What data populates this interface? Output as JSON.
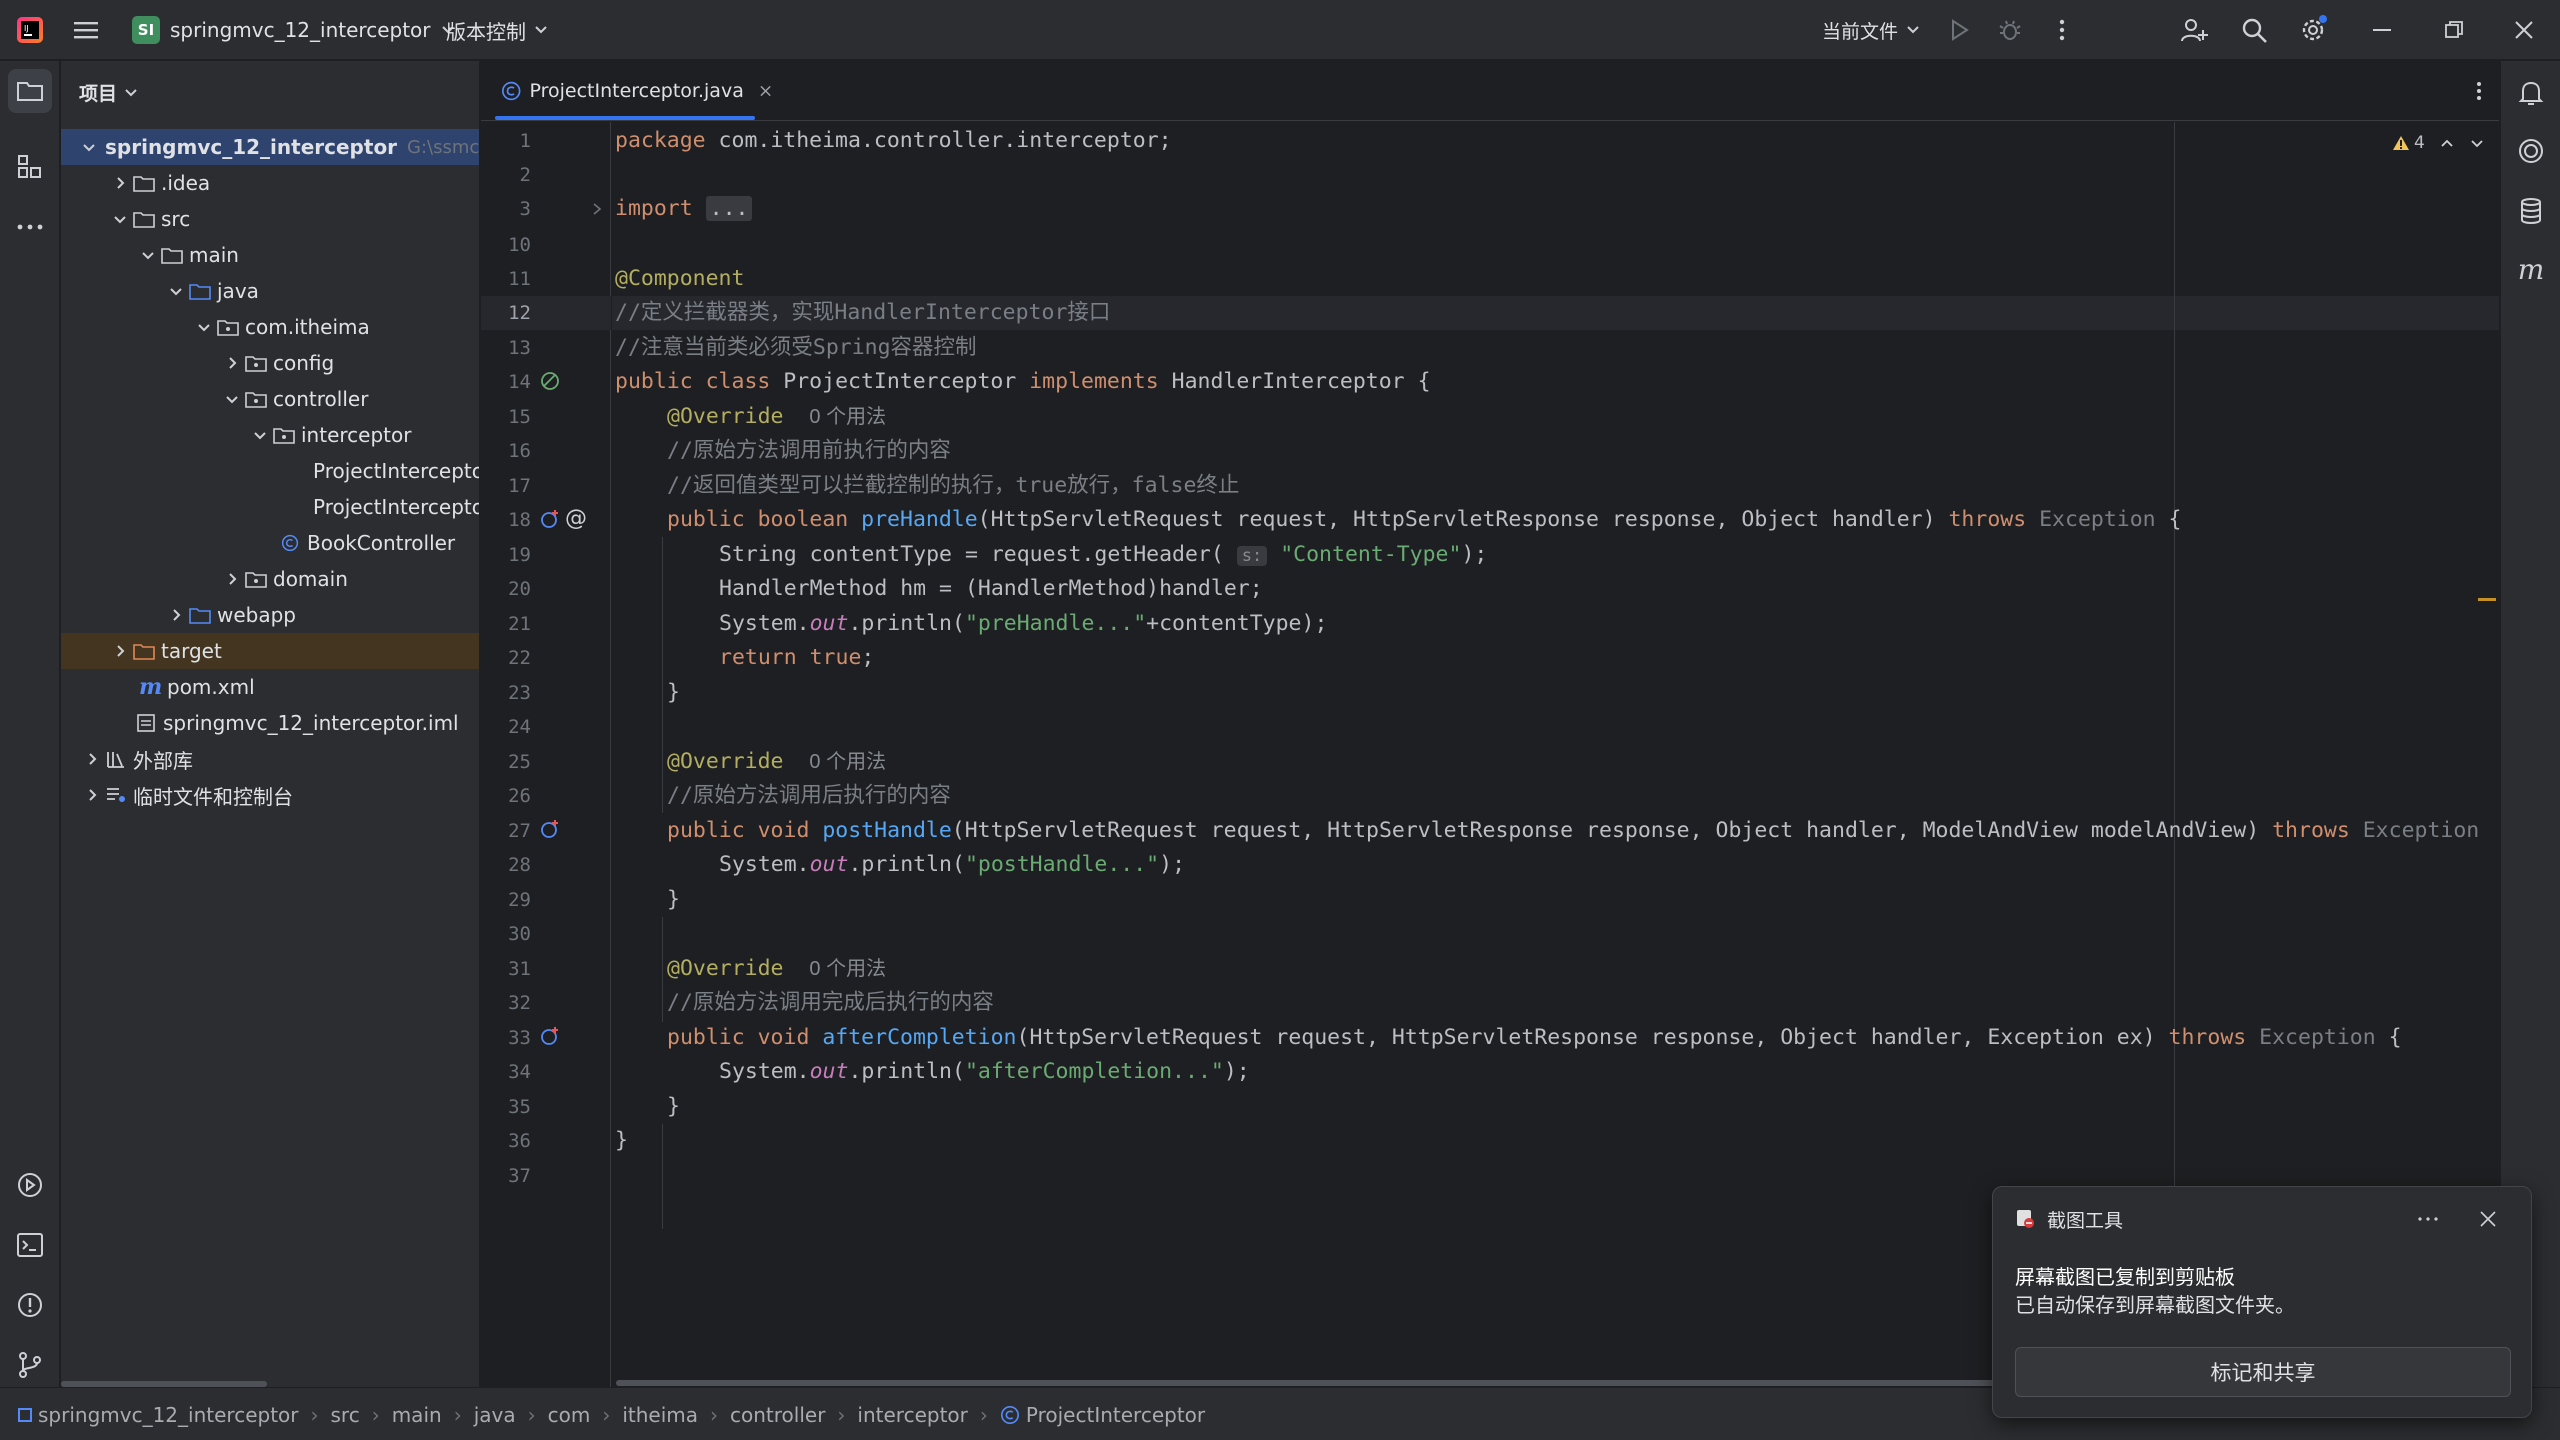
{
  "titlebar": {
    "project_badge": "SI",
    "project_name": "springmvc_12_interceptor",
    "vcs_label": "版本控制",
    "run_config": "当前文件"
  },
  "project_panel": {
    "title": "项目",
    "root_name": "springmvc_12_interceptor",
    "root_path": "G:\\ssmcode",
    "items": [
      {
        "label": ".idea"
      },
      {
        "label": "src"
      },
      {
        "label": "main"
      },
      {
        "label": "java"
      },
      {
        "label": "com.itheima"
      },
      {
        "label": "config"
      },
      {
        "label": "controller"
      },
      {
        "label": "interceptor"
      },
      {
        "label": "ProjectIntercepto"
      },
      {
        "label": "ProjectIntercepto"
      },
      {
        "label": "BookController"
      },
      {
        "label": "domain"
      },
      {
        "label": "webapp"
      },
      {
        "label": "target"
      },
      {
        "label": "pom.xml"
      },
      {
        "label": "springmvc_12_interceptor.iml"
      },
      {
        "label": "外部库"
      },
      {
        "label": "临时文件和控制台"
      }
    ]
  },
  "editor": {
    "tab_label": "ProjectInterceptor.java",
    "warnings_count": "4",
    "line_numbers": [
      "1",
      "2",
      "3",
      "10",
      "11",
      "12",
      "13",
      "14",
      "15",
      "16",
      "17",
      "18",
      "19",
      "20",
      "21",
      "22",
      "23",
      "24",
      "25",
      "26",
      "27",
      "28",
      "29",
      "30",
      "31",
      "32",
      "33",
      "34",
      "35",
      "36",
      "37"
    ],
    "code": {
      "l1_kw": "package",
      "l1_rest": " com.itheima.controller.interceptor;",
      "l3_kw": "import",
      "l3_fold": "...",
      "l11": "@Component",
      "l12": "//定义拦截器类，实现HandlerInterceptor接口",
      "l13": "//注意当前类必须受Spring容器控制",
      "l14_kw1": "public class",
      "l14_name": " ProjectInterceptor ",
      "l14_kw2": "implements",
      "l14_rest": " HandlerInterceptor {",
      "override": "@Override",
      "usage_hint": "0 个用法",
      "l16": "//原始方法调用前执行的内容",
      "l17": "//返回值类型可以拦截控制的执行，true放行，false终止",
      "l18_kw": "public boolean",
      "l18_fn": "preHandle",
      "l18_params": "(HttpServletRequest request, HttpServletResponse response, Object handler) ",
      "throws": "throws",
      "exception": "Exception",
      "l18_end": " {",
      "l19_a": "String contentType = request.getHeader(",
      "l19_hint": "s:",
      "l19_str": "\"Content-Type\"",
      "l19_end": ");",
      "l20": "HandlerMethod hm = (HandlerMethod)handler;",
      "system": "System.",
      "out": "out",
      "l21_a": ".println(",
      "l21_str": "\"preHandle...\"",
      "l21_end": "+contentType);",
      "l22_kw": "return true",
      "l22_end": ";",
      "close_brace": "}",
      "l26": "//原始方法调用后执行的内容",
      "l27_kw": "public void",
      "l27_fn": "postHandle",
      "l27_params": "(HttpServletRequest request, HttpServletResponse response, Object handler, ModelAndView modelAndView) ",
      "l28_str": "\"postHandle...\"",
      "l28_end": ");",
      "l32": "//原始方法调用完成后执行的内容",
      "l33_fn": "afterCompletion",
      "l33_params": "(HttpServletRequest request, HttpServletResponse response, Object handler, Exception ex) ",
      "l34_str": "\"afterCompletion...\""
    }
  },
  "statusbar": {
    "breadcrumbs": [
      "springmvc_12_interceptor",
      "src",
      "main",
      "java",
      "com",
      "itheima",
      "controller",
      "interceptor",
      "ProjectInterceptor"
    ]
  },
  "notification": {
    "app_name": "截图工具",
    "title": "屏幕截图已复制到剪贴板",
    "body": "已自动保存到屏幕截图文件夹。",
    "button": "标记和共享"
  },
  "colors": {
    "accent": "#3574f0",
    "keyword": "#cf8e6d",
    "annotation": "#b3ae60",
    "comment": "#7a7e85",
    "function": "#56a8f5",
    "string": "#6aab73",
    "static_field": "#c77dbb"
  }
}
